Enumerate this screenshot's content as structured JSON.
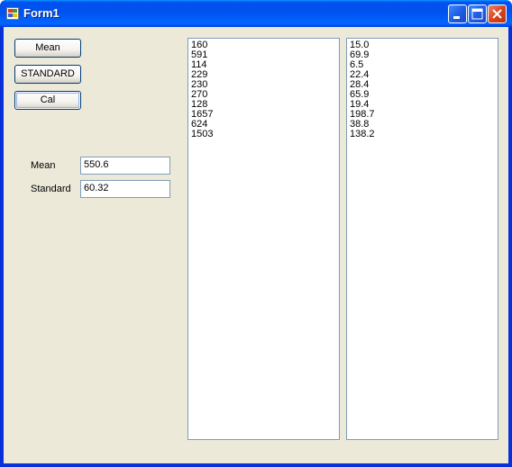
{
  "window": {
    "title": "Form1"
  },
  "buttons": {
    "mean_label": "Mean",
    "standard_label": "STANDARD",
    "cal_label": "Cal"
  },
  "fields": {
    "mean_label": "Mean",
    "mean_value": "550.6",
    "standard_label": "Standard",
    "standard_value": "60.32"
  },
  "listbox_left": {
    "items": [
      "160",
      "591",
      "114",
      "229",
      "230",
      "270",
      "128",
      "1657",
      "624",
      "1503"
    ]
  },
  "listbox_right": {
    "items": [
      "15.0",
      "69.9",
      "6.5",
      "22.4",
      "28.4",
      "65.9",
      "19.4",
      "198.7",
      "38.8",
      "138.2"
    ]
  },
  "icons": {
    "app": "form-app-icon",
    "minimize": "minimize-icon",
    "maximize": "maximize-icon",
    "close": "close-icon"
  },
  "colors": {
    "titlebar": "#0053ee",
    "client_bg": "#ece9d8",
    "close_button": "#d8451e"
  }
}
